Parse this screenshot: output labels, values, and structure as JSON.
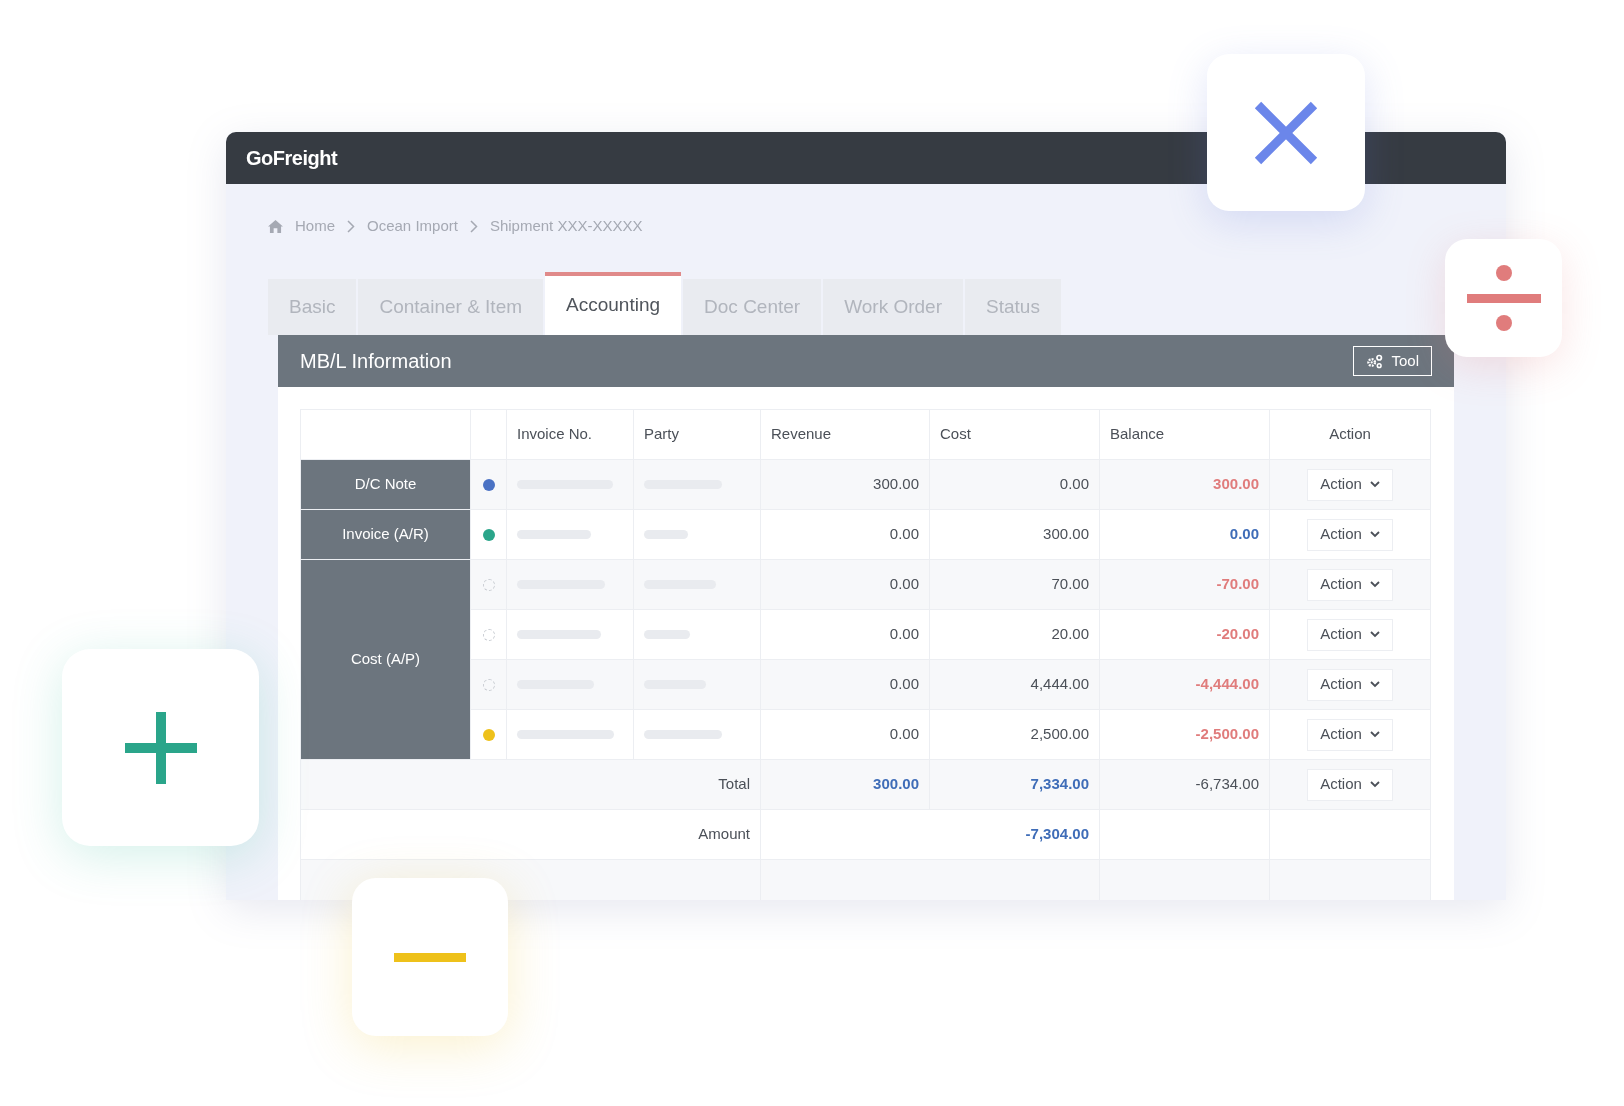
{
  "app": {
    "logo": "GoFreight"
  },
  "breadcrumb": [
    "Home",
    "Ocean Import",
    "Shipment XXX-XXXXX"
  ],
  "tabs": [
    {
      "label": "Basic",
      "selected": false
    },
    {
      "label": "Container & Item",
      "selected": false
    },
    {
      "label": "Accounting",
      "selected": true
    },
    {
      "label": "Doc Center",
      "selected": false
    },
    {
      "label": "Work Order",
      "selected": false
    },
    {
      "label": "Status",
      "selected": false
    }
  ],
  "panel": {
    "title": "MB/L Information",
    "tool_button": "Tool"
  },
  "table": {
    "columns": [
      "Invoice No.",
      "Party",
      "Revenue",
      "Cost",
      "Balance",
      "Action"
    ],
    "groups": [
      {
        "label": "D/C Note",
        "rows": [
          {
            "kind": "filled",
            "color": "#4a72c4",
            "revenue": "300.00",
            "cost": "0.00",
            "balance": {
              "value": "300.00",
              "color": "#e07c7c"
            },
            "action": "Action"
          }
        ]
      },
      {
        "label": "Invoice (A/R)",
        "rows": [
          {
            "kind": "filled",
            "color": "#2aa58a",
            "revenue": "0.00",
            "cost": "300.00",
            "balance": {
              "value": "0.00",
              "color": "#3f6db8"
            },
            "action": "Action"
          }
        ]
      },
      {
        "label": "Cost (A/P)",
        "rows": [
          {
            "kind": "empty",
            "revenue": "0.00",
            "cost": "70.00",
            "balance": {
              "value": "-70.00",
              "color": "#e07c7c"
            },
            "action": "Action"
          },
          {
            "kind": "empty",
            "revenue": "0.00",
            "cost": "20.00",
            "balance": {
              "value": "-20.00",
              "color": "#e07c7c"
            },
            "action": "Action"
          },
          {
            "kind": "empty",
            "revenue": "0.00",
            "cost": "4,444.00",
            "balance": {
              "value": "-4,444.00",
              "color": "#e07c7c"
            },
            "action": "Action"
          },
          {
            "kind": "filled",
            "color": "#eec11a",
            "revenue": "0.00",
            "cost": "2,500.00",
            "balance": {
              "value": "-2,500.00",
              "color": "#e07c7c"
            },
            "action": "Action"
          }
        ]
      }
    ],
    "total": {
      "label": "Total",
      "revenue": {
        "value": "300.00",
        "color": "#3f6db8"
      },
      "cost": {
        "value": "7,334.00",
        "color": "#3f6db8"
      },
      "balance": {
        "value": "-6,734.00"
      },
      "action": "Action"
    },
    "amount": {
      "label": "Amount",
      "total": {
        "value": "-7,304.00",
        "color": "#3f6db8"
      }
    }
  }
}
